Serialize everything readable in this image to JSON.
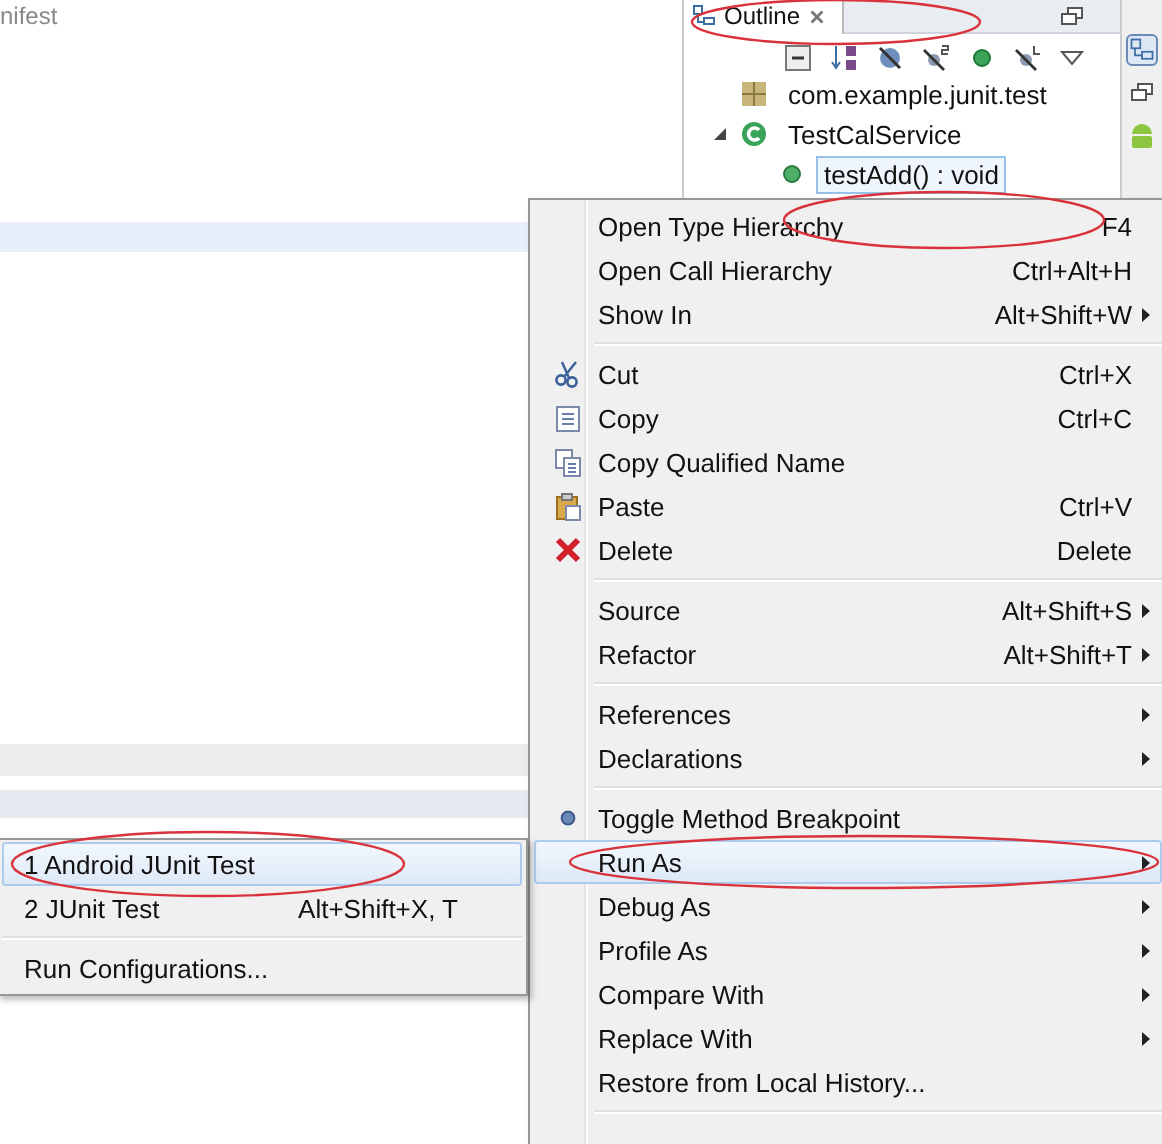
{
  "editor": {
    "tab_fragment": "nifest"
  },
  "outline": {
    "tab": {
      "label": "Outline",
      "selected": true
    },
    "tree": [
      {
        "label": "com.example.junit.test",
        "kind": "package",
        "selected": false
      },
      {
        "label": "TestCalService",
        "kind": "class",
        "expanded": true,
        "selected": false,
        "children": [
          {
            "label": "testAdd() : void",
            "kind": "method",
            "selected": true
          }
        ]
      }
    ]
  },
  "context_menu": {
    "items": [
      {
        "kind": "item",
        "label": "Open Type Hierarchy",
        "shortcut": "F4",
        "submenu": false,
        "selected": false
      },
      {
        "kind": "item",
        "label": "Open Call Hierarchy",
        "shortcut": "Ctrl+Alt+H",
        "submenu": false,
        "selected": false
      },
      {
        "kind": "item",
        "label": "Show In",
        "shortcut": "Alt+Shift+W",
        "submenu": true,
        "selected": false
      },
      {
        "kind": "separator"
      },
      {
        "kind": "item",
        "label": "Cut",
        "shortcut": "Ctrl+X",
        "submenu": false,
        "selected": false
      },
      {
        "kind": "item",
        "label": "Copy",
        "shortcut": "Ctrl+C",
        "submenu": false,
        "selected": false
      },
      {
        "kind": "item",
        "label": "Copy Qualified Name",
        "submenu": false,
        "selected": false
      },
      {
        "kind": "item",
        "label": "Paste",
        "shortcut": "Ctrl+V",
        "submenu": false,
        "selected": false
      },
      {
        "kind": "item",
        "label": "Delete",
        "shortcut": "Delete",
        "submenu": false,
        "selected": false
      },
      {
        "kind": "separator"
      },
      {
        "kind": "item",
        "label": "Source",
        "shortcut": "Alt+Shift+S",
        "submenu": true,
        "selected": false
      },
      {
        "kind": "item",
        "label": "Refactor",
        "shortcut": "Alt+Shift+T",
        "submenu": true,
        "selected": false
      },
      {
        "kind": "separator"
      },
      {
        "kind": "item",
        "label": "References",
        "submenu": true,
        "selected": false
      },
      {
        "kind": "item",
        "label": "Declarations",
        "submenu": true,
        "selected": false
      },
      {
        "kind": "separator"
      },
      {
        "kind": "item",
        "label": "Toggle Method Breakpoint",
        "submenu": false,
        "selected": false
      },
      {
        "kind": "item",
        "label": "Run As",
        "submenu": true,
        "selected": true
      },
      {
        "kind": "item",
        "label": "Debug As",
        "submenu": true,
        "selected": false
      },
      {
        "kind": "item",
        "label": "Profile As",
        "submenu": true,
        "selected": false
      },
      {
        "kind": "item",
        "label": "Compare With",
        "submenu": true,
        "selected": false
      },
      {
        "kind": "item",
        "label": "Replace With",
        "submenu": true,
        "selected": false
      },
      {
        "kind": "item",
        "label": "Restore from Local History...",
        "submenu": false,
        "selected": false
      },
      {
        "kind": "separator"
      }
    ]
  },
  "run_as_submenu": {
    "items": [
      {
        "kind": "item",
        "label": "1 Android JUnit Test",
        "selected": true
      },
      {
        "kind": "item",
        "label": "2 JUnit Test",
        "shortcut": "Alt+Shift+X, T",
        "selected": false
      },
      {
        "kind": "separator"
      },
      {
        "kind": "item",
        "label": "Run Configurations...",
        "selected": false
      }
    ]
  }
}
